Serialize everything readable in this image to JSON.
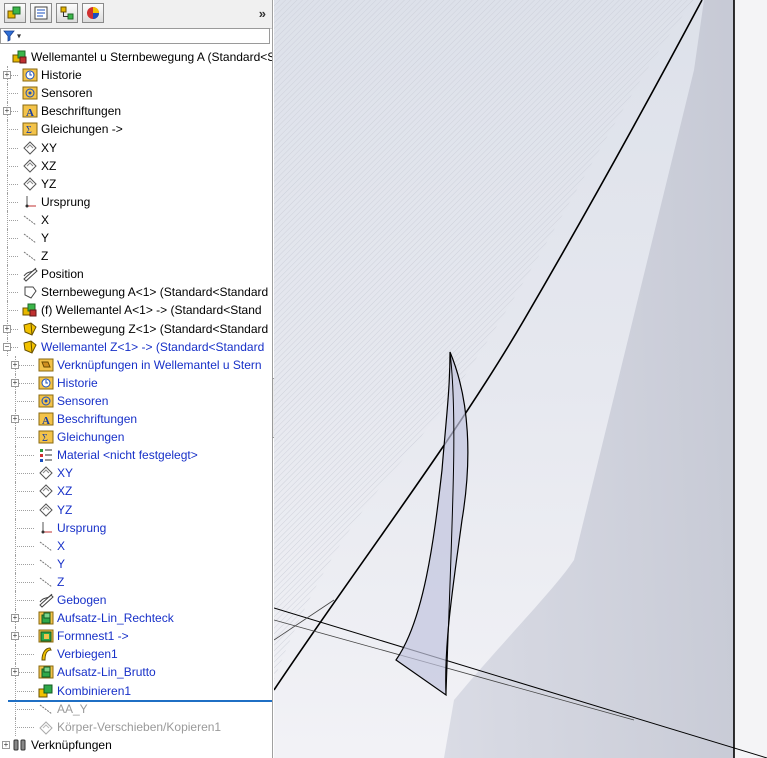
{
  "tabs": [
    {
      "name": "feature-manager-tab",
      "icon": "feature-manager-icon"
    },
    {
      "name": "property-manager-tab",
      "icon": "property-manager-icon"
    },
    {
      "name": "configuration-manager-tab",
      "icon": "configuration-manager-icon"
    },
    {
      "name": "display-manager-tab",
      "icon": "display-manager-icon"
    }
  ],
  "expand_label": "»",
  "filter_label": "▾",
  "tree": [
    {
      "label": "Wellemantel u Sternbewegung A  (Standard<S",
      "icon": "assembly-icon",
      "indent": 0,
      "expander": false,
      "style": "normal"
    },
    {
      "label": "Historie",
      "icon": "history-icon",
      "indent": 1,
      "expander": true,
      "style": "normal"
    },
    {
      "label": "Sensoren",
      "icon": "sensor-icon",
      "indent": 1,
      "expander": false,
      "style": "normal"
    },
    {
      "label": "Beschriftungen",
      "icon": "annotation-icon",
      "indent": 1,
      "expander": true,
      "style": "normal"
    },
    {
      "label": "Gleichungen ->",
      "icon": "equation-icon",
      "indent": 1,
      "expander": false,
      "style": "normal"
    },
    {
      "label": "XY",
      "icon": "plane-icon",
      "indent": 1,
      "expander": false,
      "style": "normal"
    },
    {
      "label": "XZ",
      "icon": "plane-icon",
      "indent": 1,
      "expander": false,
      "style": "normal"
    },
    {
      "label": "YZ",
      "icon": "plane-icon",
      "indent": 1,
      "expander": false,
      "style": "normal"
    },
    {
      "label": "Ursprung",
      "icon": "origin-icon",
      "indent": 1,
      "expander": false,
      "style": "normal"
    },
    {
      "label": "X",
      "icon": "axis-icon",
      "indent": 1,
      "expander": false,
      "style": "normal"
    },
    {
      "label": "Y",
      "icon": "axis-icon",
      "indent": 1,
      "expander": false,
      "style": "normal"
    },
    {
      "label": "Z",
      "icon": "axis-icon",
      "indent": 1,
      "expander": false,
      "style": "normal"
    },
    {
      "label": "Position",
      "icon": "sketch-icon",
      "indent": 1,
      "expander": false,
      "style": "normal"
    },
    {
      "label": "Sternbewegung A<1> (Standard<Standard",
      "icon": "part-outline-icon",
      "indent": 1,
      "expander": false,
      "style": "normal"
    },
    {
      "label": "(f) Wellemantel A<1> -> (Standard<Stand",
      "icon": "assembly-icon",
      "indent": 1,
      "expander": false,
      "style": "normal"
    },
    {
      "label": "Sternbewegung Z<1> (Standard<Standard",
      "icon": "part-icon",
      "indent": 1,
      "expander": true,
      "style": "normal"
    },
    {
      "label": "Wellemantel Z<1> -> (Standard<Standard",
      "icon": "part-icon",
      "indent": 1,
      "expander": "open",
      "style": "blue"
    },
    {
      "label": "Verknüpfungen in Wellemantel u Stern",
      "icon": "mates-folder-icon",
      "indent": 2,
      "expander": true,
      "style": "blue"
    },
    {
      "label": "Historie",
      "icon": "history-icon",
      "indent": 2,
      "expander": true,
      "style": "blue"
    },
    {
      "label": "Sensoren",
      "icon": "sensor-icon",
      "indent": 2,
      "expander": false,
      "style": "blue"
    },
    {
      "label": "Beschriftungen",
      "icon": "annotation-icon",
      "indent": 2,
      "expander": true,
      "style": "blue"
    },
    {
      "label": "Gleichungen",
      "icon": "equation-icon",
      "indent": 2,
      "expander": false,
      "style": "blue"
    },
    {
      "label": "Material <nicht festgelegt>",
      "icon": "material-icon",
      "indent": 2,
      "expander": false,
      "style": "blue"
    },
    {
      "label": "XY",
      "icon": "plane-icon",
      "indent": 2,
      "expander": false,
      "style": "blue"
    },
    {
      "label": "XZ",
      "icon": "plane-icon",
      "indent": 2,
      "expander": false,
      "style": "blue"
    },
    {
      "label": "YZ",
      "icon": "plane-icon",
      "indent": 2,
      "expander": false,
      "style": "blue"
    },
    {
      "label": "Ursprung",
      "icon": "origin-icon",
      "indent": 2,
      "expander": false,
      "style": "blue"
    },
    {
      "label": "X",
      "icon": "axis-icon",
      "indent": 2,
      "expander": false,
      "style": "blue"
    },
    {
      "label": "Y",
      "icon": "axis-icon",
      "indent": 2,
      "expander": false,
      "style": "blue"
    },
    {
      "label": "Z",
      "icon": "axis-icon",
      "indent": 2,
      "expander": false,
      "style": "blue"
    },
    {
      "label": "Gebogen",
      "icon": "sketch-icon",
      "indent": 2,
      "expander": false,
      "style": "blue"
    },
    {
      "label": "Aufsatz-Lin_Rechteck",
      "icon": "extrude-icon",
      "indent": 2,
      "expander": true,
      "style": "blue"
    },
    {
      "label": "Formnest1 ->",
      "icon": "cavity-icon",
      "indent": 2,
      "expander": true,
      "style": "blue"
    },
    {
      "label": "Verbiegen1",
      "icon": "flex-icon",
      "indent": 2,
      "expander": false,
      "style": "blue"
    },
    {
      "label": "Aufsatz-Lin_Brutto",
      "icon": "extrude-icon",
      "indent": 2,
      "expander": true,
      "style": "blue"
    },
    {
      "label": "Kombinieren1",
      "icon": "combine-icon",
      "indent": 2,
      "expander": false,
      "style": "blue"
    },
    {
      "label": "AA_Y",
      "icon": "axis-icon",
      "indent": 2,
      "expander": false,
      "style": "gray"
    },
    {
      "label": "Körper-Verschieben/Kopieren1",
      "icon": "move-copy-icon",
      "indent": 2,
      "expander": false,
      "style": "gray"
    },
    {
      "label": "Verknüpfungen",
      "icon": "mates-icon",
      "indent": 0,
      "expander": true,
      "style": "normal"
    }
  ],
  "colors": {
    "selected_blue": "#1730c8",
    "suppressed_gray": "#9a9a9a",
    "rollback_bar": "#1f6fc4"
  }
}
